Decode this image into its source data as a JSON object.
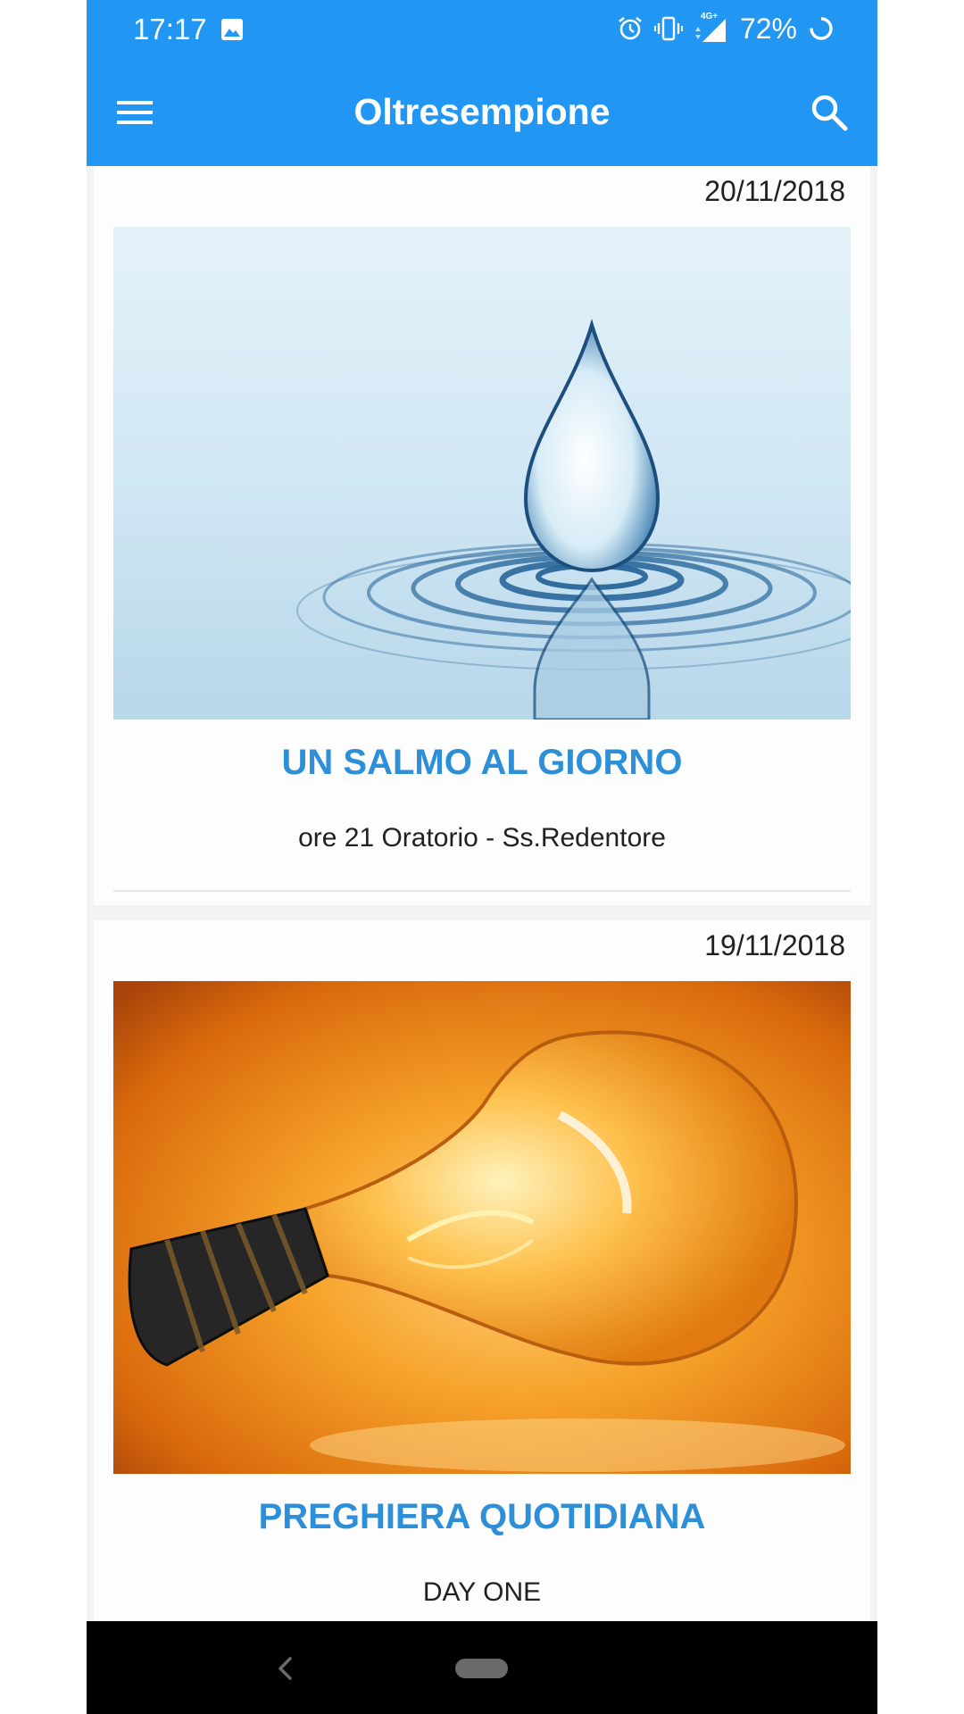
{
  "status_bar": {
    "time": "17:17",
    "network": "4G+",
    "battery": "72%",
    "icons": [
      "image-icon",
      "alarm-icon",
      "vibrate-icon",
      "signal-icon",
      "battery-saver-icon"
    ]
  },
  "app_bar": {
    "title": "Oltresempione",
    "menu_icon": "hamburger-menu-icon",
    "search_icon": "search-icon"
  },
  "feed": {
    "items": [
      {
        "date": "20/11/2018",
        "image": "water-drop-ripple-image",
        "title": "UN SALMO AL GIORNO",
        "subtitle": "ore 21 Oratorio - Ss.Redentore"
      },
      {
        "date": "19/11/2018",
        "image": "light-bulb-image",
        "title": "PREGHIERA QUOTIDIANA",
        "subtitle": "DAY ONE"
      }
    ]
  },
  "nav_bar": {
    "back_icon": "back-chevron-icon",
    "home_icon": "home-pill-icon"
  },
  "colors": {
    "primary": "#2196f3",
    "title_text": "#2d8fd8",
    "nav_bar": "#000000"
  }
}
